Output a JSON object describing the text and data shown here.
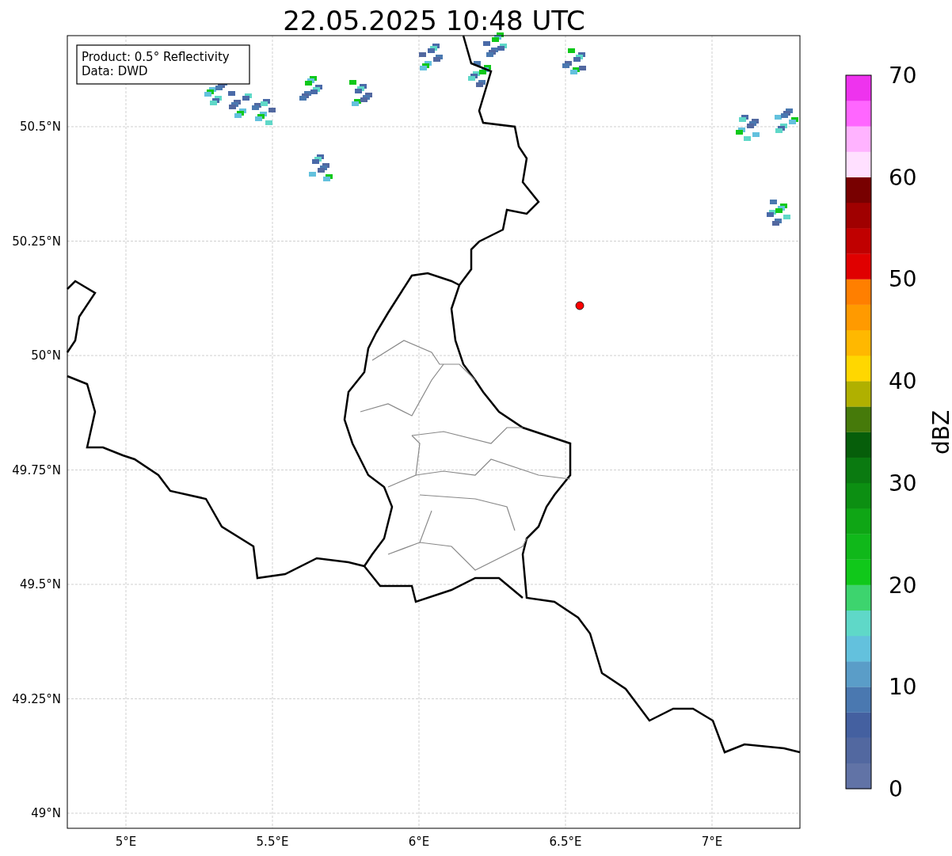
{
  "title": "22.05.2025 10:48 UTC",
  "map": {
    "legend_lines": [
      "Product: 0.5° Reflectivity",
      "Data: DWD"
    ],
    "y_ticks": [
      "50.5°N",
      "50.25°N",
      "50°N",
      "49.75°N",
      "49.5°N",
      "49.25°N",
      "49°N"
    ],
    "x_ticks": [
      "5°E",
      "5.5°E",
      "6°E",
      "6.5°E",
      "7°E"
    ]
  },
  "colorbar": {
    "label": "dBZ",
    "ticks": [
      "70",
      "60",
      "50",
      "40",
      "30",
      "20",
      "10",
      "0"
    ],
    "segments": [
      {
        "color": "#6173a6"
      },
      {
        "color": "#5268a0"
      },
      {
        "color": "#4460a0"
      },
      {
        "color": "#4a78b0"
      },
      {
        "color": "#5a9dc8"
      },
      {
        "color": "#63c1dd"
      },
      {
        "color": "#5fd8c8"
      },
      {
        "color": "#3dd46e"
      },
      {
        "color": "#10c81a"
      },
      {
        "color": "#10b81a"
      },
      {
        "color": "#0fa615"
      },
      {
        "color": "#0c8f12"
      },
      {
        "color": "#0a7a10"
      },
      {
        "color": "#065e0a"
      },
      {
        "color": "#467a0a"
      },
      {
        "color": "#b0b000"
      },
      {
        "color": "#ffd700"
      },
      {
        "color": "#ffb800"
      },
      {
        "color": "#ff9a00"
      },
      {
        "color": "#ff7f00"
      },
      {
        "color": "#e00000"
      },
      {
        "color": "#c00000"
      },
      {
        "color": "#a00000"
      },
      {
        "color": "#780000"
      },
      {
        "color": "#ffe0ff"
      },
      {
        "color": "#ffb3ff"
      },
      {
        "color": "#ff66ff"
      },
      {
        "color": "#ee33ee"
      }
    ]
  }
}
